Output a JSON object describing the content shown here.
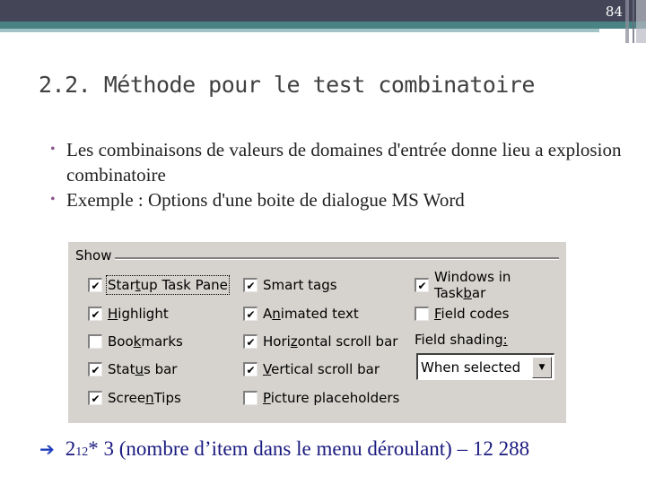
{
  "header": {
    "slide_number": "84",
    "colors": {
      "dark": "#444657",
      "teal": "#4a8384",
      "light": "#a2c3c6"
    }
  },
  "title": "2.2. Méthode pour le test combinatoire",
  "bullets": [
    {
      "text": "Les combinaisons de valeurs de domaines d'entrée donne lieu a explosion combinatoire"
    },
    {
      "text": "Exemple : Options d'une boite de dialogue MS Word"
    }
  ],
  "dialog": {
    "group_label": "Show",
    "columns": [
      [
        {
          "label_pre": "Star",
          "label_u": "t",
          "label_post": "up Task Pane",
          "checked": true,
          "focused": true
        },
        {
          "label_pre": "",
          "label_u": "H",
          "label_post": "ighlight",
          "checked": true
        },
        {
          "label_pre": "Boo",
          "label_u": "k",
          "label_post": "marks",
          "checked": false
        },
        {
          "label_pre": "Stat",
          "label_u": "u",
          "label_post": "s bar",
          "checked": true
        },
        {
          "label_pre": "Scree",
          "label_u": "n",
          "label_post": "Tips",
          "checked": true
        }
      ],
      [
        {
          "label_pre": "Smart ta",
          "label_u": "g",
          "label_post": "s",
          "checked": true
        },
        {
          "label_pre": "A",
          "label_u": "n",
          "label_post": "imated text",
          "checked": true
        },
        {
          "label_pre": "Hori",
          "label_u": "z",
          "label_post": "ontal scroll bar",
          "checked": true
        },
        {
          "label_pre": "",
          "label_u": "V",
          "label_post": "ertical scroll bar",
          "checked": true
        },
        {
          "label_pre": "",
          "label_u": "P",
          "label_post": "icture placeholders",
          "checked": false
        }
      ],
      [
        {
          "label_pre": "Windows in Task",
          "label_u": "b",
          "label_post": "ar",
          "checked": true
        },
        {
          "label_pre": "",
          "label_u": "F",
          "label_post": "ield codes",
          "checked": false
        }
      ]
    ],
    "field_shading": {
      "label_pre": "Field shading",
      "label_u": ":",
      "selected": "When selected",
      "icon": "dropdown-arrow-icon"
    }
  },
  "formula": {
    "arrow_icon": "right-arrow-icon",
    "base": "2",
    "exponent": "12",
    "rest": " * 3 (nombre d’item dans le menu déroulant) – 12 288"
  }
}
